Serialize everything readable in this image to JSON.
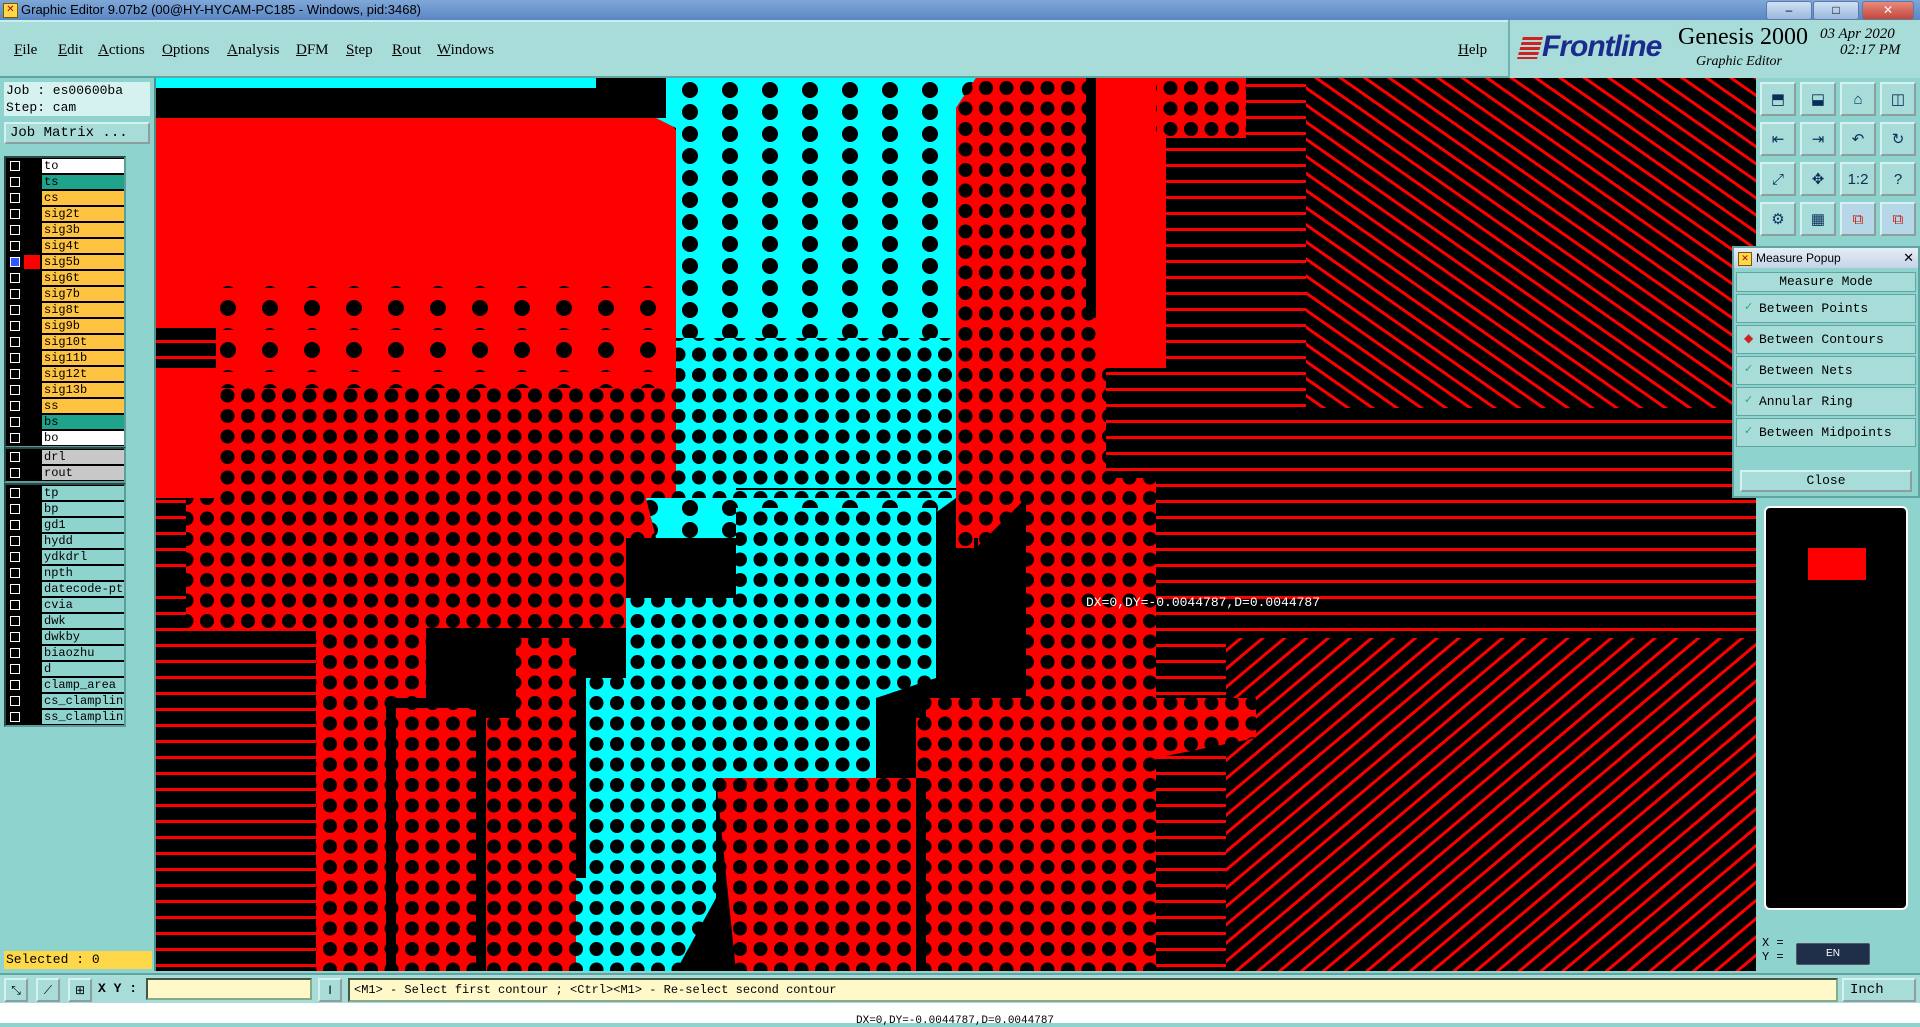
{
  "window": {
    "title": "Graphic Editor 9.07b2 (00@HY-HYCAM-PC185 - Windows, pid:3468)",
    "icon": "genesis-app-icon"
  },
  "menu": [
    "File",
    "Edit",
    "Actions",
    "Options",
    "Analysis",
    "DFM",
    "Step",
    "Rout",
    "Windows"
  ],
  "help_label": "Help",
  "brand": {
    "logo": "Frontline",
    "product": "Genesis 2000",
    "subtitle": "Graphic Editor",
    "date": "03 Apr 2020",
    "time": "02:17 PM"
  },
  "left_panel": {
    "job": "Job : es00600ba",
    "step": "Step: cam",
    "job_matrix_button": "Job Matrix ...",
    "layer_groups": [
      [
        {
          "name": "to",
          "color": "#ffffff"
        },
        {
          "name": "ts",
          "color": "#1fa38a"
        },
        {
          "name": "cs",
          "color": "#ffc342"
        },
        {
          "name": "sig2t",
          "color": "#ffc342"
        },
        {
          "name": "sig3b",
          "color": "#ffc342"
        },
        {
          "name": "sig4t",
          "color": "#ffc342"
        },
        {
          "name": "sig5b",
          "color": "#ffc342",
          "swatch": "#ff0000",
          "checked": true
        },
        {
          "name": "sig6t",
          "color": "#ffc342"
        },
        {
          "name": "sig7b",
          "color": "#ffc342"
        },
        {
          "name": "sig8t",
          "color": "#ffc342"
        },
        {
          "name": "sig9b",
          "color": "#ffc342"
        },
        {
          "name": "sig10t",
          "color": "#ffc342"
        },
        {
          "name": "sig11b",
          "color": "#ffc342"
        },
        {
          "name": "sig12t",
          "color": "#ffc342"
        },
        {
          "name": "sig13b",
          "color": "#ffc342"
        },
        {
          "name": "ss",
          "color": "#ffc342"
        },
        {
          "name": "bs",
          "color": "#1fa38a"
        },
        {
          "name": "bo",
          "color": "#ffffff"
        }
      ],
      [
        {
          "name": "drl",
          "color": "#c8c8c8"
        },
        {
          "name": "rout",
          "color": "#c8c8c8"
        }
      ],
      [
        {
          "name": "tp",
          "color": "#8fd3cf"
        },
        {
          "name": "bp",
          "color": "#8fd3cf"
        },
        {
          "name": "gd1",
          "color": "#8fd3cf"
        },
        {
          "name": "hydd",
          "color": "#8fd3cf"
        },
        {
          "name": "ydkdrl",
          "color": "#8fd3cf"
        },
        {
          "name": "npth",
          "color": "#8fd3cf"
        },
        {
          "name": "datecode-pt",
          "color": "#8fd3cf"
        },
        {
          "name": "cvia",
          "color": "#8fd3cf"
        },
        {
          "name": "dwk",
          "color": "#8fd3cf"
        },
        {
          "name": "dwkby",
          "color": "#8fd3cf"
        },
        {
          "name": "biaozhu",
          "color": "#8fd3cf"
        },
        {
          "name": "d",
          "color": "#8fd3cf"
        },
        {
          "name": "clamp_area",
          "color": "#8fd3cf"
        },
        {
          "name": "cs_clamplin",
          "color": "#8fd3cf"
        },
        {
          "name": "ss_clamplin",
          "color": "#8fd3cf"
        }
      ]
    ],
    "selected": "Selected : 0"
  },
  "canvas": {
    "measure_text": "DX=0,DY=-0.0044787,D=0.0044787",
    "colors": {
      "copper": "#ff0000",
      "other_layer": "#00ffff",
      "background": "#000000"
    }
  },
  "toolbar_icons": [
    "zoom-home-icon",
    "zoom-back-icon",
    "home-icon",
    "window-icon",
    "pan-left-icon",
    "pan-right-icon",
    "undo-icon",
    "redraw-icon",
    "fit-screen-icon",
    "zoom-fit-icon",
    "ratio-icon",
    "help-icon",
    "snap-icon",
    "grid-icon",
    "layers-red-icon",
    "layers-blue-icon"
  ],
  "measure_popup": {
    "title": "Measure Popup",
    "close_x": "✕",
    "heading": "Measure Mode",
    "options": [
      {
        "label": "Between Points",
        "selected": false
      },
      {
        "label": "Between Contours",
        "selected": true
      },
      {
        "label": "Between Nets",
        "selected": false
      },
      {
        "label": "Annular Ring",
        "selected": false
      },
      {
        "label": "Between Midpoints",
        "selected": false
      }
    ],
    "close_label": "Close"
  },
  "coords": {
    "x_label": "X =",
    "y_label": "Y =",
    "ime": "EN"
  },
  "bottom": {
    "xy_label": "X Y :",
    "prompt": "<M1> - Select first contour ; <Ctrl><M1> - Re-select second contour",
    "unit": "Inch",
    "status": "DX=0,DY=-0.0044787,D=0.0044787"
  }
}
